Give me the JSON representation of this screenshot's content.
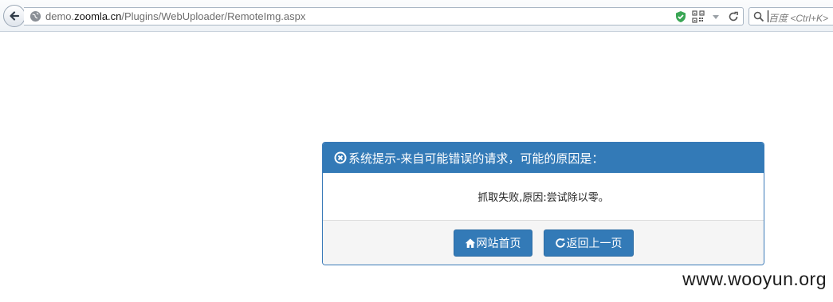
{
  "browser": {
    "url": {
      "prefix": "demo.",
      "host": "zoomla.cn",
      "path": "/Plugins/WebUploader/RemoteImg.aspx"
    },
    "search_placeholder": "百度 <Ctrl+K>"
  },
  "dialog": {
    "title": "系统提示-来自可能错误的请求，可能的原因是：",
    "message": "抓取失败,原因:尝试除以零。",
    "buttons": {
      "home": "网站首页",
      "back": "返回上一页"
    }
  },
  "watermark": "www.wooyun.org",
  "colors": {
    "primary": "#337ab7",
    "footer_bg": "#f5f5f5",
    "shield_green": "#3aa655"
  },
  "icons": {
    "back": "back-arrow-icon",
    "globe": "globe-icon",
    "shield": "shield-icon",
    "qr": "qr-code-icon",
    "dropdown": "dropdown-arrow-icon",
    "reload": "reload-icon",
    "search": "search-icon",
    "header": "times-circle-icon",
    "home": "home-icon",
    "refresh": "refresh-icon"
  }
}
